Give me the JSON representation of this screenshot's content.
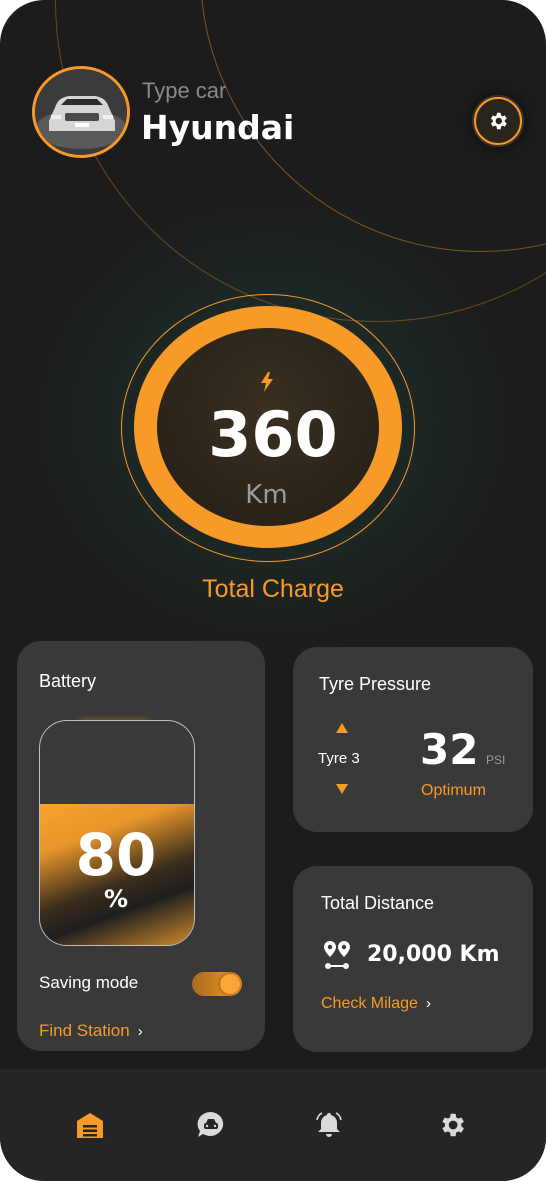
{
  "header": {
    "type_label": "Type car",
    "car_name": "Hyundai",
    "avatar_icon": "car-photo",
    "settings_icon": "gear-icon"
  },
  "gauge": {
    "icon": "lightning-bolt-icon",
    "value": "360",
    "unit": "Km",
    "label": "Total Charge"
  },
  "battery": {
    "title": "Battery",
    "value": "80",
    "unit": "%",
    "level": 0.63,
    "saving_mode_label": "Saving mode",
    "saving_mode_on": true,
    "find_station_label": "Find Station",
    "chevron": "›"
  },
  "tyre": {
    "title": "Tyre Pressure",
    "tyre_label": "Tyre 3",
    "value": "32",
    "unit": "PSI",
    "status": "Optimum"
  },
  "distance": {
    "title": "Total Distance",
    "value": "20,000 Km",
    "link_label": "Check Milage",
    "chevron": "›"
  },
  "nav": {
    "items": [
      {
        "icon": "garage-icon",
        "active": true
      },
      {
        "icon": "chat-car-icon",
        "active": false
      },
      {
        "icon": "bell-icon",
        "active": false
      },
      {
        "icon": "gear-icon",
        "active": false
      }
    ]
  },
  "colors": {
    "accent": "#f79a28",
    "background": "#1c1c1c",
    "card": "#393939",
    "nav": "#252525"
  }
}
